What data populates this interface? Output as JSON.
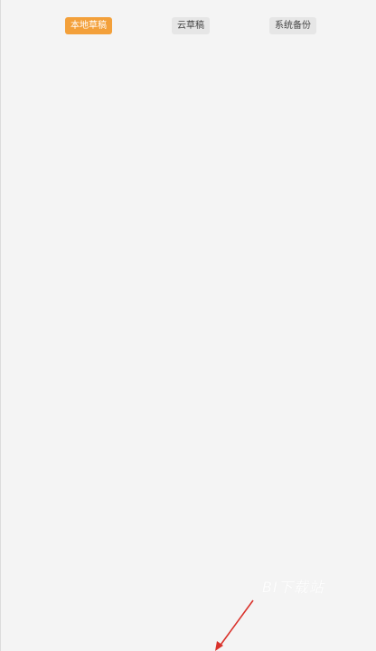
{
  "tabs": [
    {
      "label": "本地草稿",
      "state": "active"
    },
    {
      "label": "云草稿",
      "state": "inactive"
    },
    {
      "label": "系统备份",
      "state": "inactive"
    }
  ],
  "watermark": {
    "text": "BI下载站"
  },
  "colors": {
    "background": "#f4f4f4",
    "active_tab": "#f3a03a",
    "inactive_tab": "#e6e6e6",
    "arrow": "#d9322b"
  },
  "icons": {
    "pointer": "red-arrow-icon"
  }
}
